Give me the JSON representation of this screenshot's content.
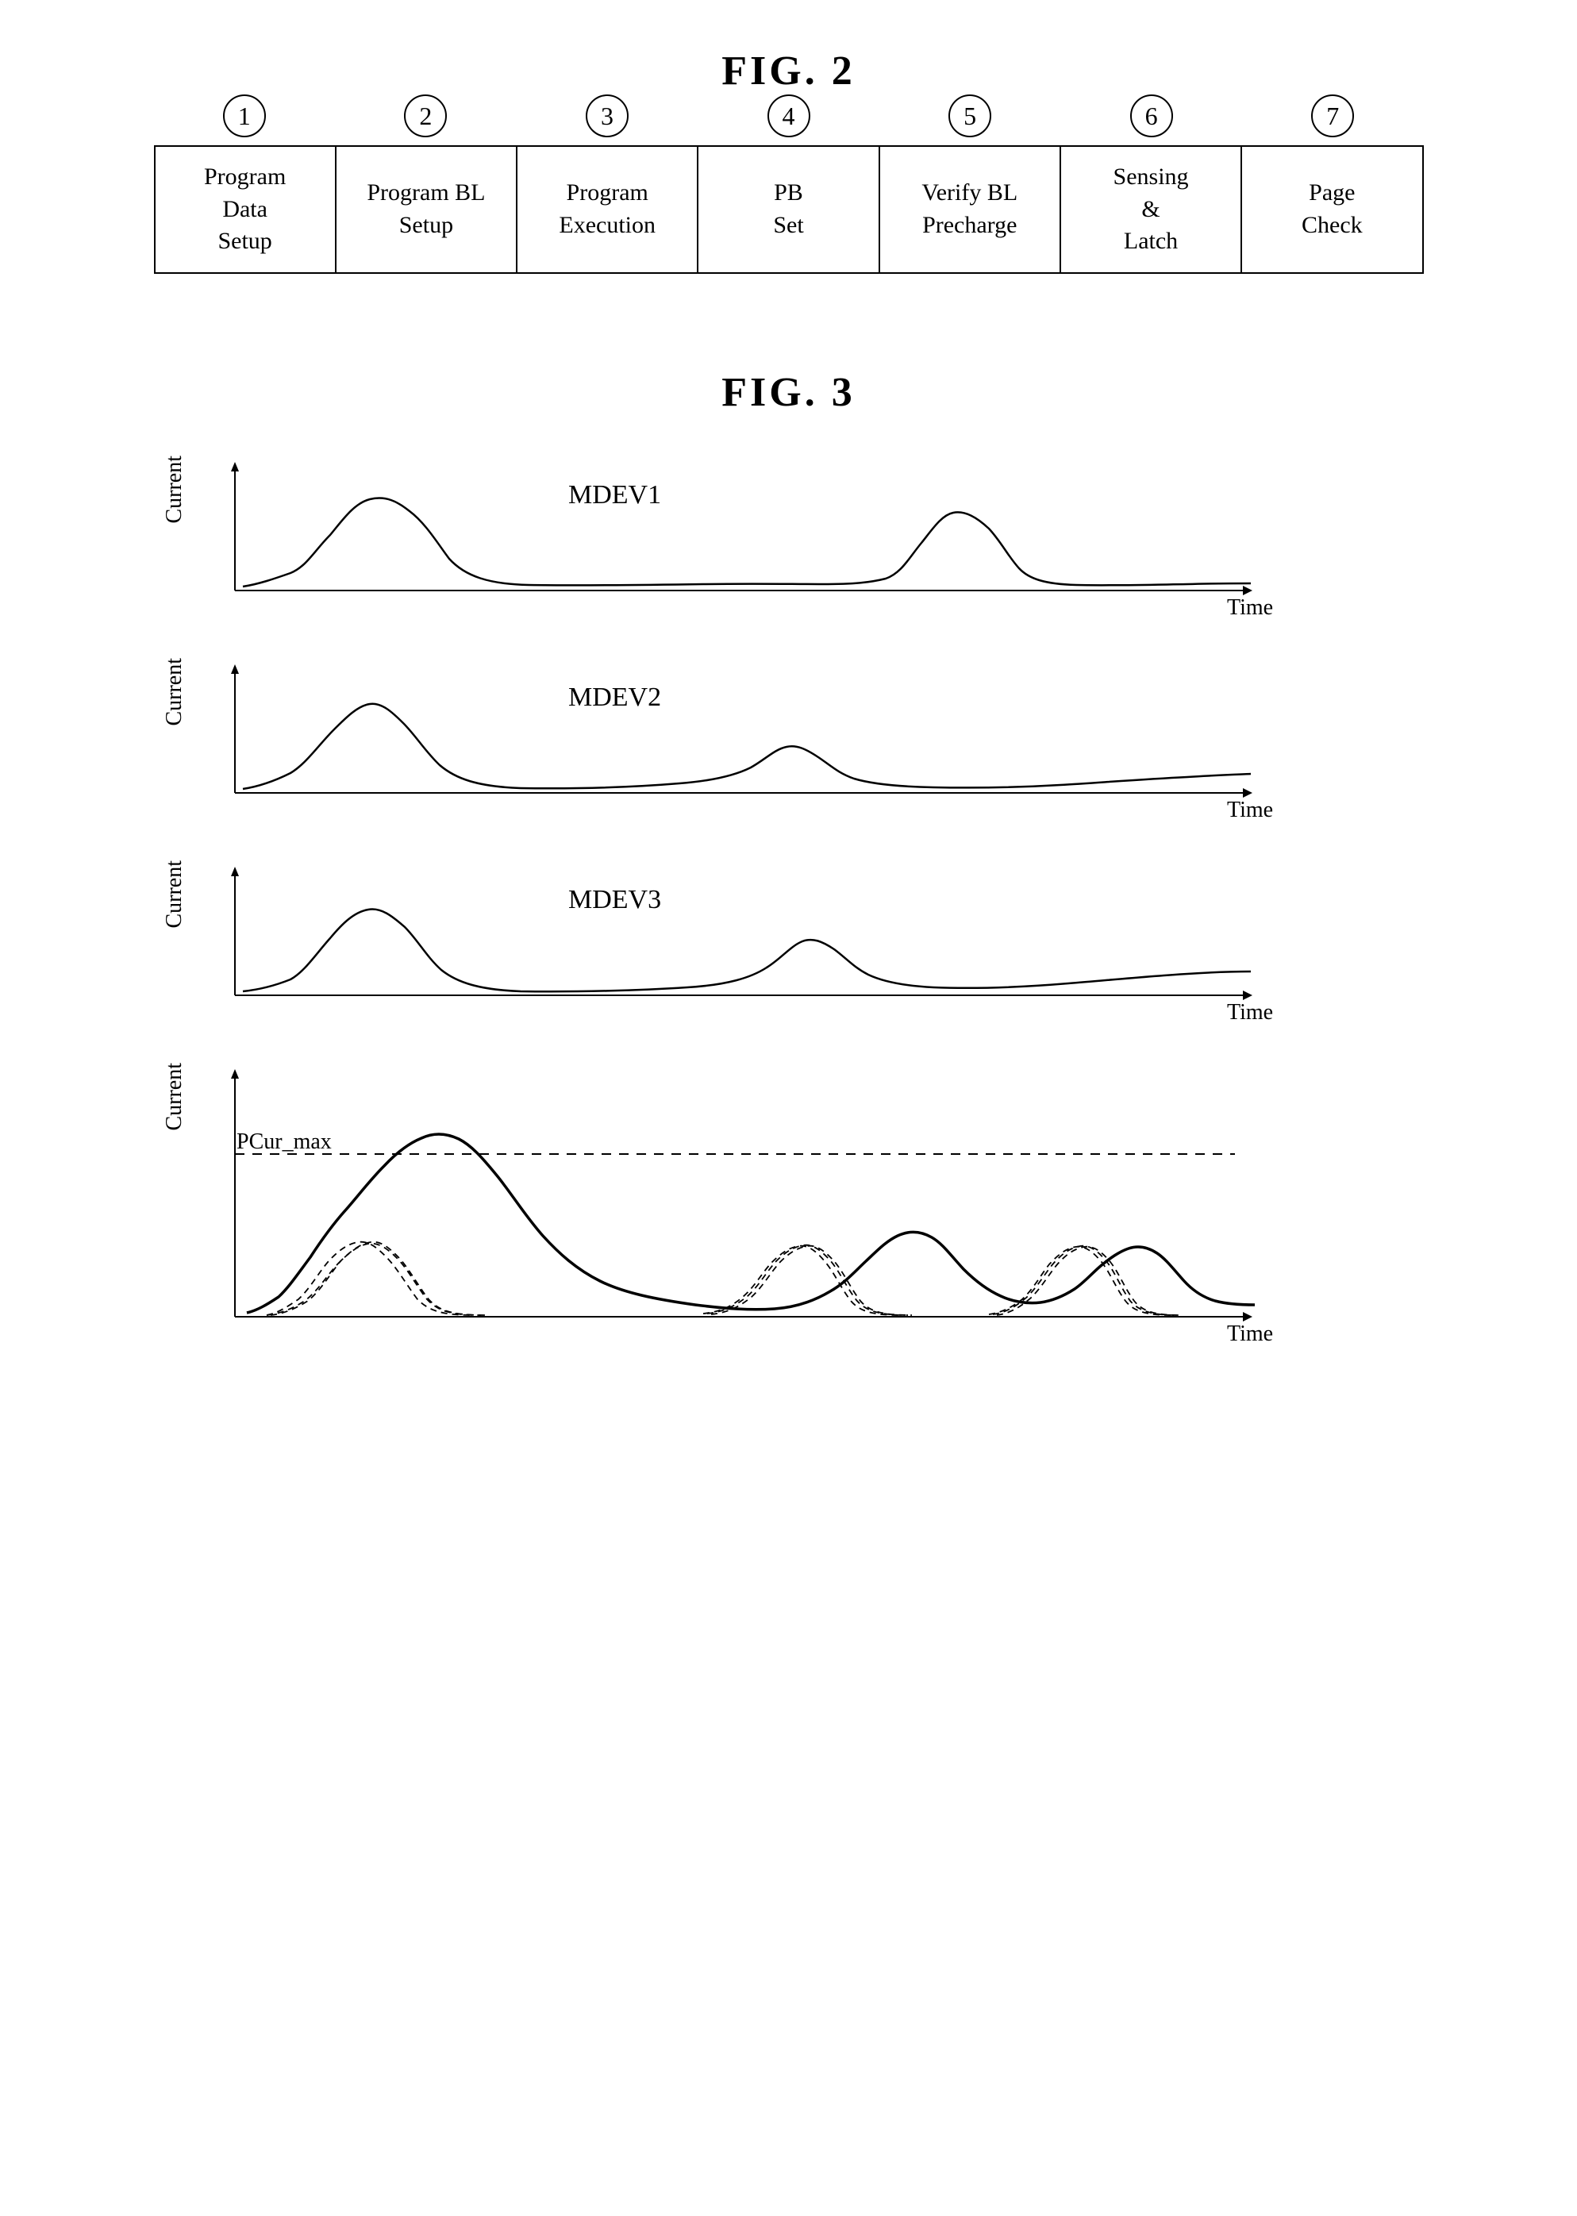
{
  "fig2": {
    "title": "FIG. 2",
    "steps": [
      {
        "num": "1",
        "label": "Program\nData\nSetup"
      },
      {
        "num": "2",
        "label": "Program BL\nSetup"
      },
      {
        "num": "3",
        "label": "Program\nExecution"
      },
      {
        "num": "4",
        "label": "PB\nSet"
      },
      {
        "num": "5",
        "label": "Verify BL\nPrecharge"
      },
      {
        "num": "6",
        "label": "Sensing\n&\nLatch"
      },
      {
        "num": "7",
        "label": "Page\nCheck"
      }
    ]
  },
  "fig3": {
    "title": "FIG. 3",
    "charts": [
      {
        "id": "mdev1",
        "label": "MDEV1"
      },
      {
        "id": "mdev2",
        "label": "MDEV2"
      },
      {
        "id": "mdev3",
        "label": "MDEV3"
      },
      {
        "id": "combined",
        "label": "PCur_max"
      }
    ],
    "axis": {
      "current": "Current",
      "time": "Time"
    }
  }
}
